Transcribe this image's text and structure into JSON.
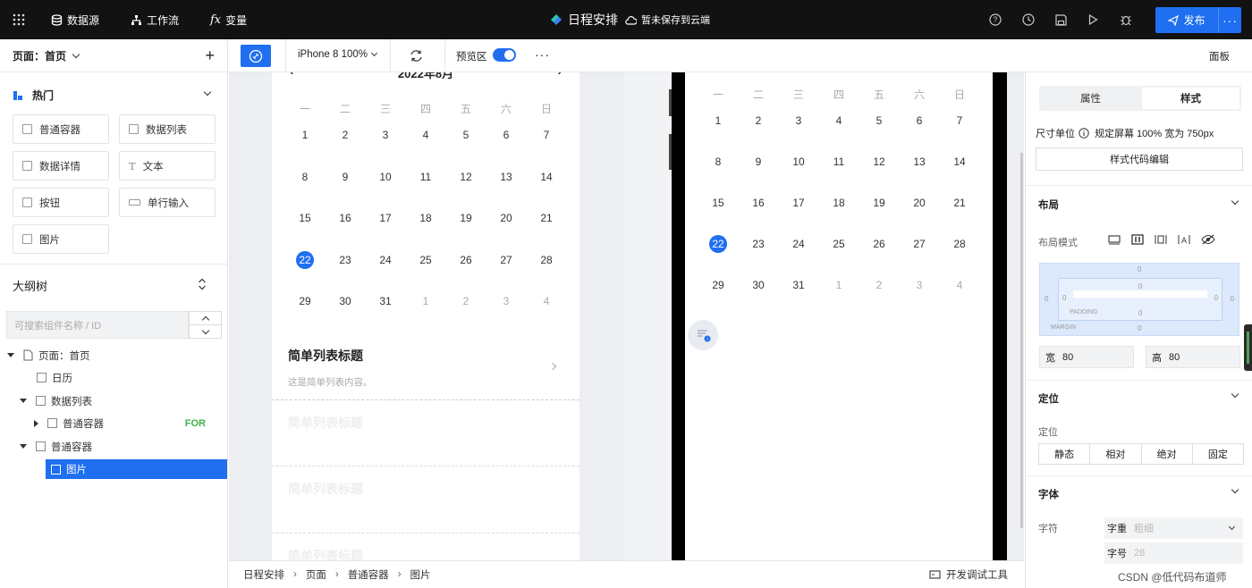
{
  "topbar": {
    "datasource": "数据源",
    "workflow": "工作流",
    "variables": "变量",
    "app_title": "日程安排",
    "save_status": "暂未保存到云端",
    "publish": "发布",
    "publish_more": "···"
  },
  "left_panel": {
    "page_selector": "页面：首页",
    "add": "+",
    "section_hot": "热门",
    "components": [
      "普通容器",
      "数据列表",
      "数据详情",
      "文本",
      "按钮",
      "单行输入",
      "图片"
    ],
    "outline_title": "大纲树",
    "search_placeholder": "可搜索组件名称 / ID",
    "tree": [
      {
        "label": "页面：首页"
      },
      {
        "label": "日历"
      },
      {
        "label": "数据列表"
      },
      {
        "label": "普通容器",
        "badge": "FOR"
      },
      {
        "label": "普通容器"
      },
      {
        "label": "图片"
      }
    ]
  },
  "toolbar": {
    "device": "iPhone 8 100%",
    "preview_label": "预览区",
    "more": "···",
    "panel": "面板"
  },
  "calendar": {
    "month": "2022年8月",
    "weekdays": [
      "一",
      "二",
      "三",
      "四",
      "五",
      "六",
      "日"
    ],
    "weeks": [
      [
        "1",
        "2",
        "3",
        "4",
        "5",
        "6",
        "7"
      ],
      [
        "8",
        "9",
        "10",
        "11",
        "12",
        "13",
        "14"
      ],
      [
        "15",
        "16",
        "17",
        "18",
        "19",
        "20",
        "21"
      ],
      [
        "22",
        "23",
        "24",
        "25",
        "26",
        "27",
        "28"
      ],
      [
        "29",
        "30",
        "31",
        "1",
        "2",
        "3",
        "4"
      ]
    ],
    "selected": "22"
  },
  "list": {
    "title": "简单列表标题",
    "desc": "这是简单列表内容。",
    "faded_title": "简单列表标题"
  },
  "right_panel": {
    "tab_props": "属性",
    "tab_style": "样式",
    "unit_label": "尺寸单位",
    "unit_desc": "规定屏幕 100% 宽为 750px",
    "style_code_btn": "样式代码编辑",
    "layout_title": "布局",
    "layout_mode": "布局模式",
    "padding": "PADDING",
    "margin": "MARGIN",
    "box_zero": "0",
    "width_label": "宽",
    "width_value": "80",
    "height_label": "高",
    "height_value": "80",
    "position_title": "定位",
    "position_label": "定位",
    "positions": [
      "静态",
      "相对",
      "绝对",
      "固定"
    ],
    "font_title": "字体",
    "font_char": "字符",
    "weight_label": "字重",
    "weight_placeholder": "粗细",
    "size_label": "字号",
    "size_placeholder": "28"
  },
  "breadcrumb": [
    "日程安排",
    "页面",
    "普通容器",
    "图片"
  ],
  "dev_tools": "开发调试工具",
  "watermark": "CSDN @低代码布道师",
  "colors": {
    "accent": "#1f6ff0",
    "topbar": "#121212",
    "badge": "#3db04a"
  }
}
